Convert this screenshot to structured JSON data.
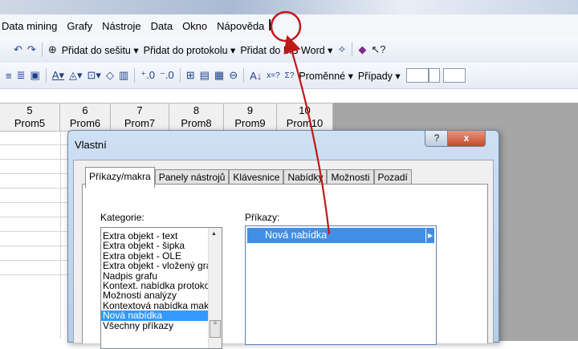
{
  "menubar": {
    "items": [
      "Data mining",
      "Grafy",
      "Nástroje",
      "Data",
      "Okno",
      "Nápověda"
    ]
  },
  "toolbar1": {
    "add_to_workbook": "Přidat do sešitu ▾",
    "add_to_report": "Přidat do protokolu ▾",
    "add_to_word": "Přidat do MS Word ▾"
  },
  "toolbar2": {
    "variables": "Proměnné ▾",
    "cases": "Případy ▾"
  },
  "sheet": {
    "columns": [
      {
        "num": "5",
        "name": "Prom5"
      },
      {
        "num": "6",
        "name": "Prom6"
      },
      {
        "num": "7",
        "name": "Prom7"
      },
      {
        "num": "8",
        "name": "Prom8"
      },
      {
        "num": "9",
        "name": "Prom9"
      },
      {
        "num": "10",
        "name": "Prom10"
      }
    ]
  },
  "dialog": {
    "title": "Vlastní",
    "help_label": "?",
    "close_label": "x",
    "tabs": [
      "Příkazy/makra",
      "Panely nástrojů",
      "Klávesnice",
      "Nabídky",
      "Možnosti",
      "Pozadí"
    ],
    "categories_label": "Kategorie:",
    "commands_label": "Příkazy:",
    "categories": [
      "Extra objekt - text",
      "Extra objekt - šipka",
      "Extra objekt - OLE",
      "Extra objekt - vložený graf",
      "Nadpis grafu",
      "Kontext. nabídka protokolu",
      "Možnosti analýzy",
      "Kontextová nabídka makra",
      "Nová nabídka",
      "Všechny příkazy"
    ],
    "selected_category": "Nová nabídka",
    "commands": [
      "Nová nabídka"
    ]
  }
}
